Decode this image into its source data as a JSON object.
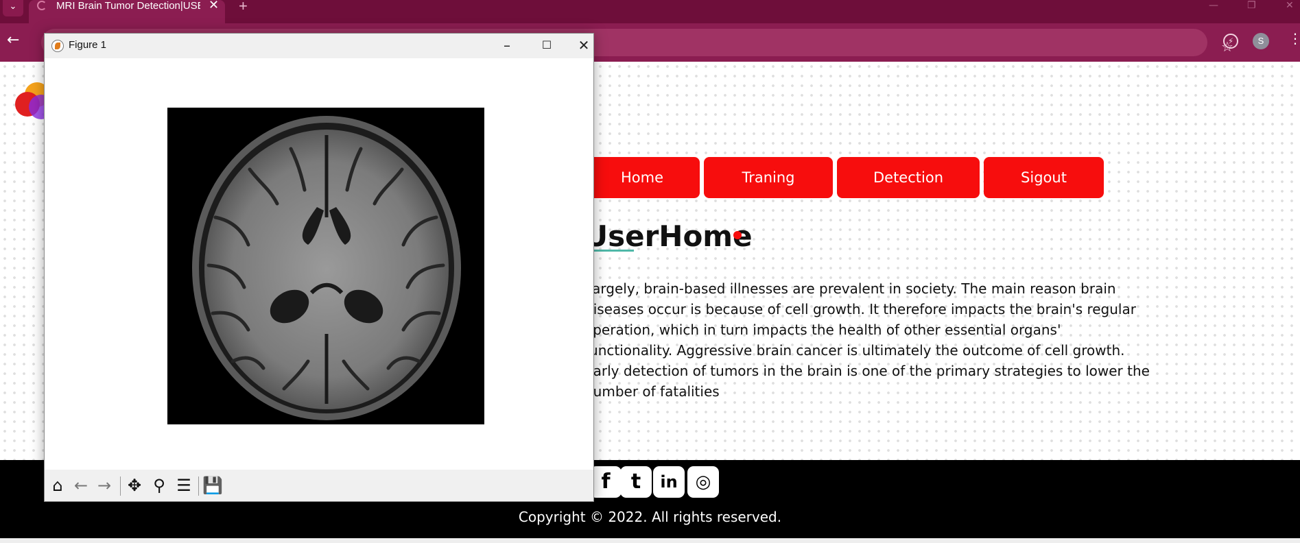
{
  "browser": {
    "tab_title": "MRI Brain Tumor Detection|USER",
    "tab_close": "✕",
    "new_tab": "+",
    "back": "←",
    "profile_initial": "S"
  },
  "figure_window": {
    "title": "Figure 1",
    "minimize": "–",
    "maximize": "☐",
    "close": "✕",
    "toolbar_icons": [
      "home-icon",
      "back-arrow-icon",
      "forward-arrow-icon",
      "pan-icon",
      "zoom-icon",
      "configure-subplots-icon",
      "save-icon"
    ]
  },
  "nav": {
    "home": "Home",
    "training": "Traning",
    "detection": "Detection",
    "signout": "Sigout"
  },
  "heading": "UserHome",
  "body_lines": [
    "Largely, brain-based illnesses are prevalent in society. The main reason brain",
    "diseases occur is because of cell growth. It therefore impacts the brain's regular",
    "operation, which in turn impacts the health of other essential organs'",
    "functionality. Aggressive brain cancer is ultimately the outcome of cell growth.",
    "Early detection of tumors in the brain is one of the primary strategies to lower the",
    "number of fatalities"
  ],
  "footer": {
    "social": [
      "facebook-icon",
      "twitter-icon",
      "linkedin-icon",
      "instagram-icon"
    ],
    "copyright": "Copyright © 2022. All rights reserved."
  },
  "colors": {
    "browser_frame": "#8b1d51",
    "nav_button": "#f70d0d",
    "heading_dot": "#f70d0d",
    "underline": "#4fb8a8"
  }
}
